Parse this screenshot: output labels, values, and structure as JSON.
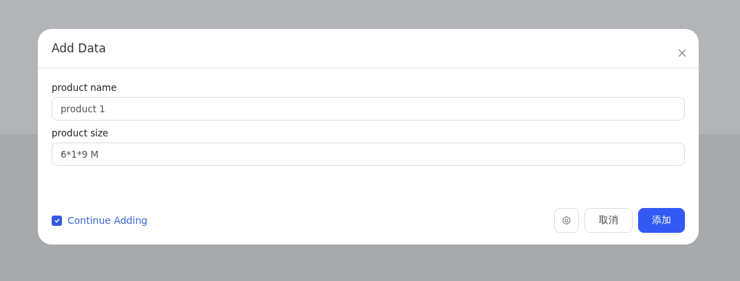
{
  "dialog": {
    "title": "Add Data",
    "fields": [
      {
        "label": "product name",
        "value": "product 1"
      },
      {
        "label": "product size",
        "value": "6*1*9 M"
      }
    ],
    "continue_adding": {
      "label": "Continue Adding",
      "checked": true
    },
    "buttons": [
      {
        "label": "取消",
        "kind": "secondary"
      },
      {
        "label": "添加",
        "kind": "primary"
      }
    ]
  }
}
